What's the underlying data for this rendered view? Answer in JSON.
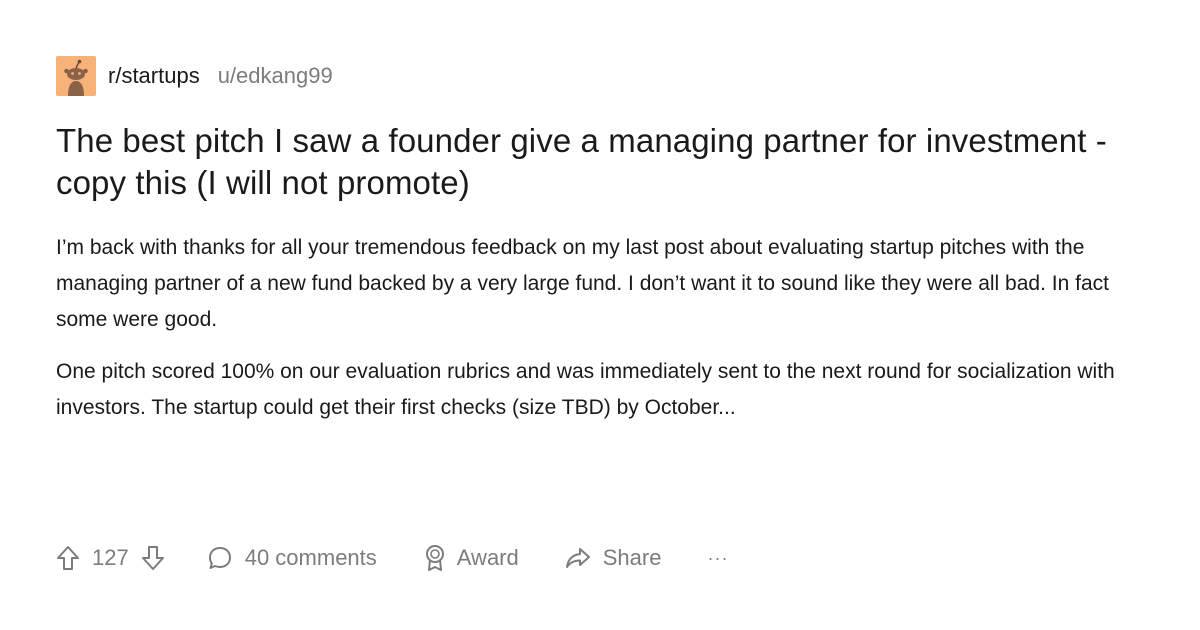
{
  "post": {
    "subreddit": "r/startups",
    "author": "u/edkang99",
    "title": "The best pitch I saw a founder give a managing partner for investment  - copy this (I will not promote)",
    "paragraphs": [
      "I’m back with thanks for all your tremendous feedback on my last post about evaluating startup pitches with the managing partner of a new fund backed by a very large fund. I don’t want it to sound like they were all bad. In fact some were good.",
      "One pitch scored 100% on our evaluation rubrics and was immediately sent to the next round for socialization with investors. The startup could get their first checks (size TBD) by October..."
    ]
  },
  "actions": {
    "upvote_icon": "arrow-up-icon",
    "vote_count": "127",
    "downvote_icon": "arrow-down-icon",
    "comments_icon": "comment-bubble-icon",
    "comments_label": "40 comments",
    "award_icon": "award-icon",
    "award_label": "Award",
    "share_icon": "share-arrow-icon",
    "share_label": "Share",
    "more_label": "···"
  },
  "colors": {
    "text": "#1a1a1b",
    "muted": "#7c7c7c",
    "avatar_bg": "#f7b27a"
  }
}
